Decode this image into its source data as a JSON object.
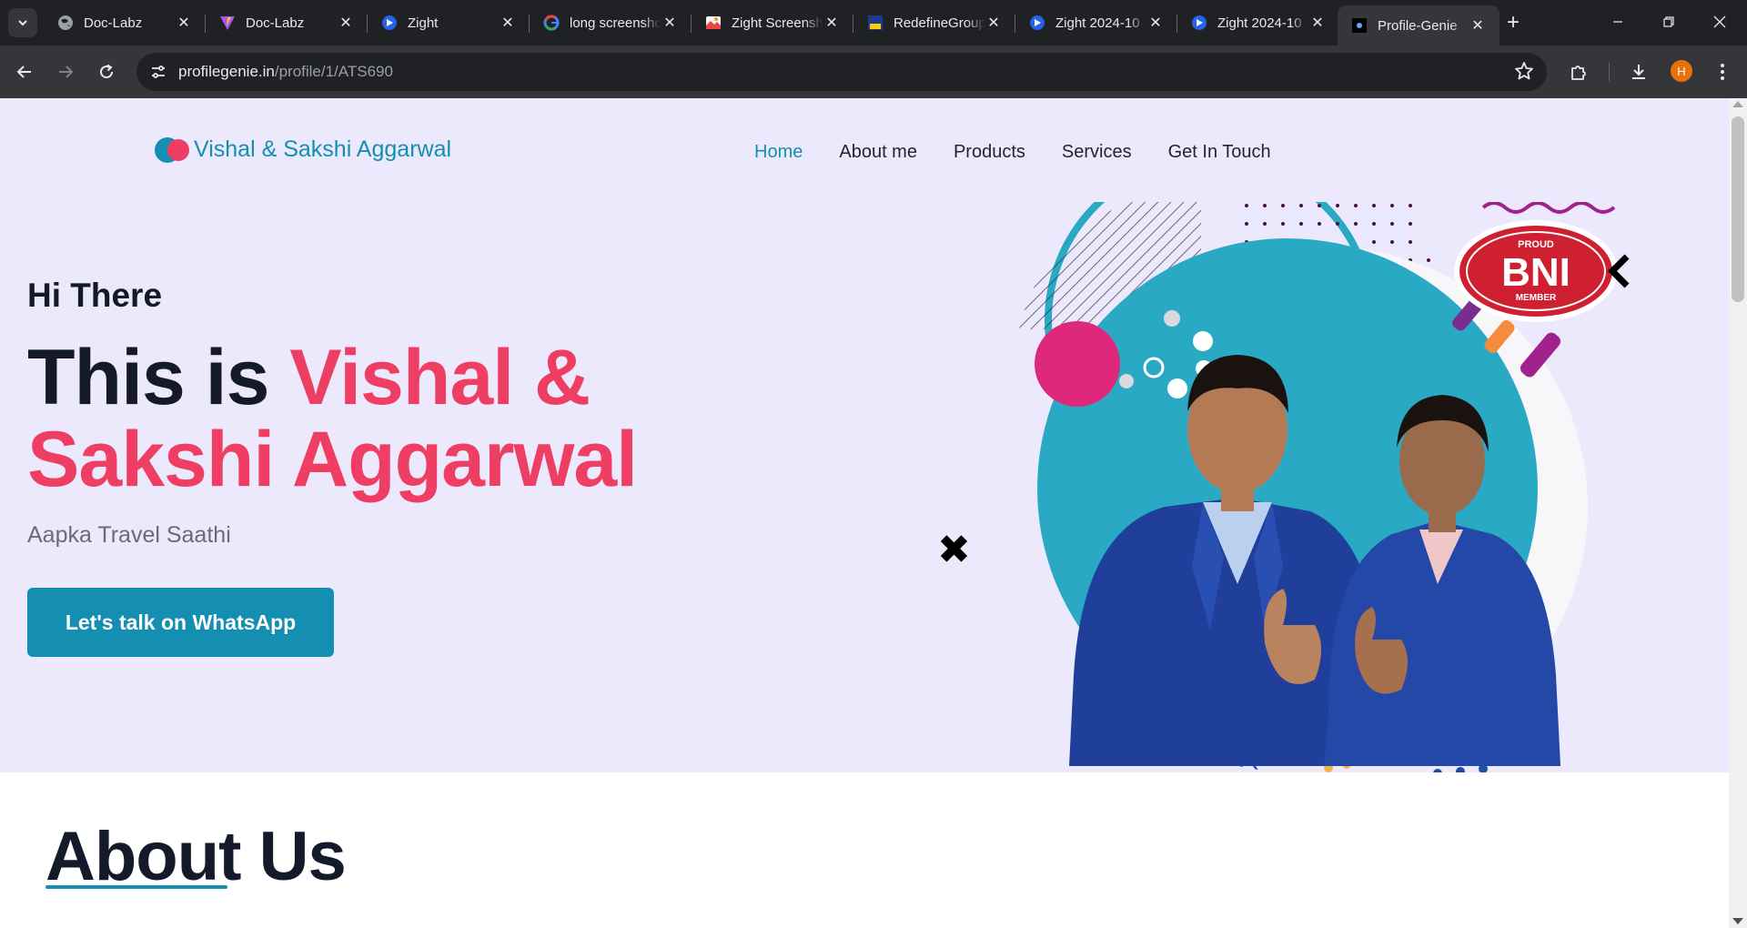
{
  "browser": {
    "tabs": [
      {
        "title": "Doc-Labz",
        "icon": "globe-icon"
      },
      {
        "title": "Doc-Labz",
        "icon": "vite-icon"
      },
      {
        "title": "Zight",
        "icon": "zight-icon"
      },
      {
        "title": "long screenshot",
        "icon": "google-icon"
      },
      {
        "title": "Zight Screenshot",
        "icon": "zight-screen-icon"
      },
      {
        "title": "RedefineGroup",
        "icon": "redefine-icon"
      },
      {
        "title": "Zight 2024-10",
        "icon": "zight-icon"
      },
      {
        "title": "Zight 2024-10",
        "icon": "zight-icon"
      },
      {
        "title": "Profile-Genie",
        "icon": "profile-genie-icon",
        "active": true
      }
    ],
    "url_domain": "profilegenie.in",
    "url_path": "/profile/1/ATS690",
    "profile_initial": "H"
  },
  "site": {
    "brand_name": "Vishal & Sakshi Aggarwal",
    "nav": [
      {
        "label": "Home",
        "active": true
      },
      {
        "label": "About me"
      },
      {
        "label": "Products"
      },
      {
        "label": "Services"
      },
      {
        "label": "Get In Touch"
      }
    ],
    "hero": {
      "greeting": "Hi There",
      "headline_prefix": "This is ",
      "headline_highlight": "Vishal & Sakshi Aggarwal",
      "tagline": "Aapka Travel Saathi",
      "cta_label": "Let's talk on WhatsApp",
      "badge_top": "PROUD",
      "badge_main": "BNI",
      "badge_bottom": "MEMBER"
    },
    "about_heading": "About Us"
  },
  "colors": {
    "accent_teal": "#148fb1",
    "accent_pink": "#ef3e63",
    "hero_bg": "#ece9fc",
    "dark_text": "#151a2a"
  }
}
